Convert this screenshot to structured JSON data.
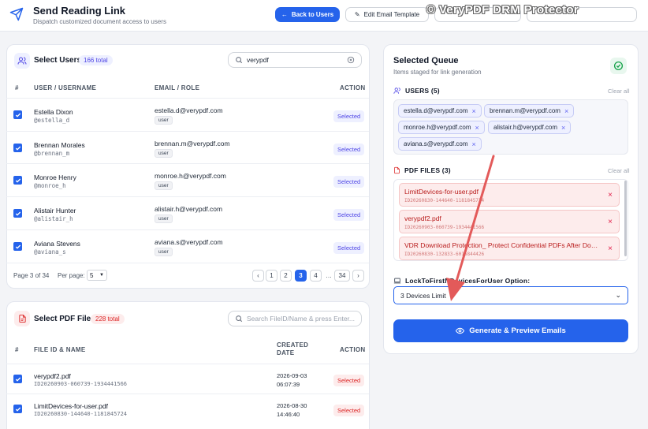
{
  "header": {
    "title": "Send Reading Link",
    "subtitle": "Dispatch customized document access to users",
    "back_label": "Back to Users",
    "edit_template_label": "Edit Email Template",
    "watermark": "© VeryPDF DRM Protector"
  },
  "users_card": {
    "title": "Select Users",
    "total": "166 total",
    "search_value": "verypdf",
    "columns": [
      "#",
      "USER / USERNAME",
      "EMAIL / ROLE",
      "ACTION"
    ],
    "rows": [
      {
        "name": "Estella Dixon",
        "handle": "@estella_d",
        "email": "estella.d@verypdf.com",
        "role": "user",
        "action": "Selected"
      },
      {
        "name": "Brennan Morales",
        "handle": "@brennan_m",
        "email": "brennan.m@verypdf.com",
        "role": "user",
        "action": "Selected"
      },
      {
        "name": "Monroe Henry",
        "handle": "@monroe_h",
        "email": "monroe.h@verypdf.com",
        "role": "user",
        "action": "Selected"
      },
      {
        "name": "Alistair Hunter",
        "handle": "@alistair_h",
        "email": "alistair.h@verypdf.com",
        "role": "user",
        "action": "Selected"
      },
      {
        "name": "Aviana Stevens",
        "handle": "@aviana_s",
        "email": "aviana.s@verypdf.com",
        "role": "user",
        "action": "Selected"
      }
    ],
    "page_info": "Page 3 of 34",
    "per_page_label": "Per page:",
    "per_page_value": "5",
    "pages": [
      "‹",
      "1",
      "2",
      "3",
      "4",
      "…",
      "34",
      "›"
    ],
    "active_page": "3"
  },
  "pdf_card": {
    "title": "Select PDF Files",
    "total": "228 total",
    "search_placeholder": "Search FileID/Name & press Enter...",
    "columns": [
      "#",
      "FILE ID & NAME",
      "CREATED",
      "DATE",
      "ACTION"
    ],
    "rows": [
      {
        "name": "verypdf2.pdf",
        "id": "ID20260903-060739-1934441566",
        "date": "2026-09-03",
        "time": "06:07:39",
        "action": "Selected"
      },
      {
        "name": "LimitDevices-for-user.pdf",
        "id": "ID20260830-144640-1181845724",
        "date": "2026-08-30",
        "time": "14:46:40",
        "action": "Selected"
      }
    ]
  },
  "queue": {
    "title": "Selected Queue",
    "subtitle": "Items staged for link generation",
    "users_label": "USERS (5)",
    "clear_all": "Clear all",
    "user_chips": [
      "estella.d@verypdf.com",
      "brennan.m@verypdf.com",
      "monroe.h@verypdf.com",
      "alistair.h@verypdf.com",
      "aviana.s@verypdf.com"
    ],
    "files_label": "PDF FILES (3)",
    "files": [
      {
        "name": "LimitDevices-for-user.pdf",
        "id": "ID20260830-144640-1181845724"
      },
      {
        "name": "verypdf2.pdf",
        "id": "ID20260903-060739-1934441566"
      },
      {
        "name": "VDR Download Protection_ Protect Confidential PDFs After Downloa...",
        "id": "ID20260830-132833-6015844426"
      }
    ],
    "option_label": "LockToFirstNDevicesForUser Option:",
    "option_value": "3 Devices Limit",
    "generate_label": "Generate & Preview Emails"
  },
  "colors": {
    "accent": "#2563eb",
    "selected_red": "#dc2626",
    "arrow": "#e35a5a"
  }
}
